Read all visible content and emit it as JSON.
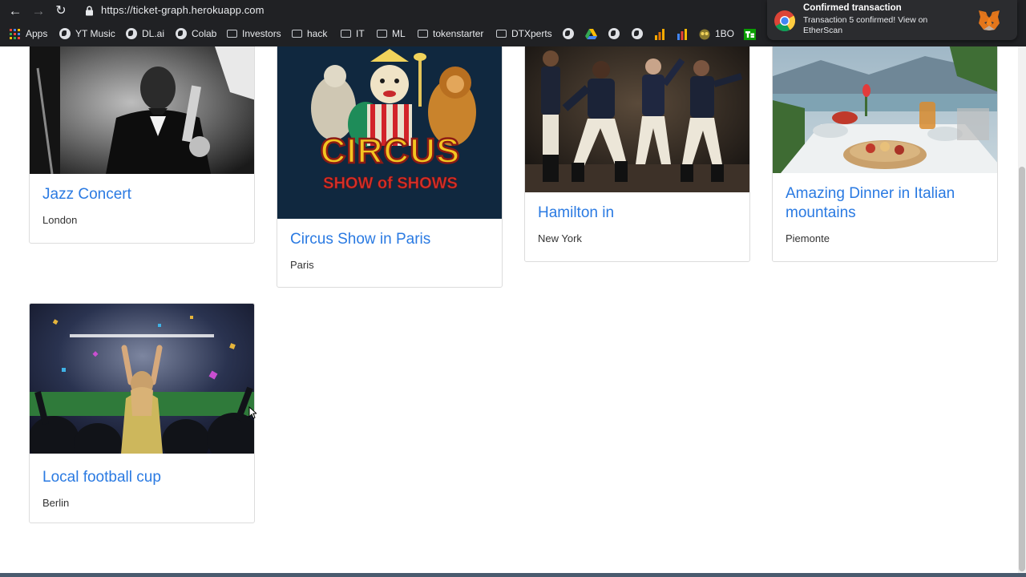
{
  "browser": {
    "url": "https://ticket-graph.herokuapp.com",
    "bookmarks": [
      {
        "label": "Apps",
        "icon": "apps-grid-icon"
      },
      {
        "label": "YT Music",
        "icon": "globe-icon"
      },
      {
        "label": "DL.ai",
        "icon": "globe-icon"
      },
      {
        "label": "Colab",
        "icon": "globe-icon"
      },
      {
        "label": "Investors",
        "icon": "folder-icon"
      },
      {
        "label": "hack",
        "icon": "folder-icon"
      },
      {
        "label": "IT",
        "icon": "folder-icon"
      },
      {
        "label": "ML",
        "icon": "folder-icon"
      },
      {
        "label": "tokenstarter",
        "icon": "folder-icon"
      },
      {
        "label": "DTXperts",
        "icon": "folder-icon"
      },
      {
        "label": "1BO",
        "icon": "globe-icon"
      }
    ]
  },
  "notification": {
    "title": "Confirmed transaction",
    "body": "Transaction 5 confirmed! View on EtherScan"
  },
  "events": [
    {
      "title": "Jazz Concert",
      "city": "London"
    },
    {
      "title": "Circus Show in Paris",
      "city": "Paris"
    },
    {
      "title": "Hamilton in",
      "city": "New York"
    },
    {
      "title": "Amazing Dinner in Italian mountains",
      "city": "Piemonte"
    },
    {
      "title": "Local football cup",
      "city": "Berlin"
    }
  ],
  "circus_poster": {
    "line1": "CIRCUS",
    "line2": "SHOW of SHOWS"
  },
  "colors": {
    "link": "#2a7ae2",
    "chrome_bar": "#202124"
  }
}
